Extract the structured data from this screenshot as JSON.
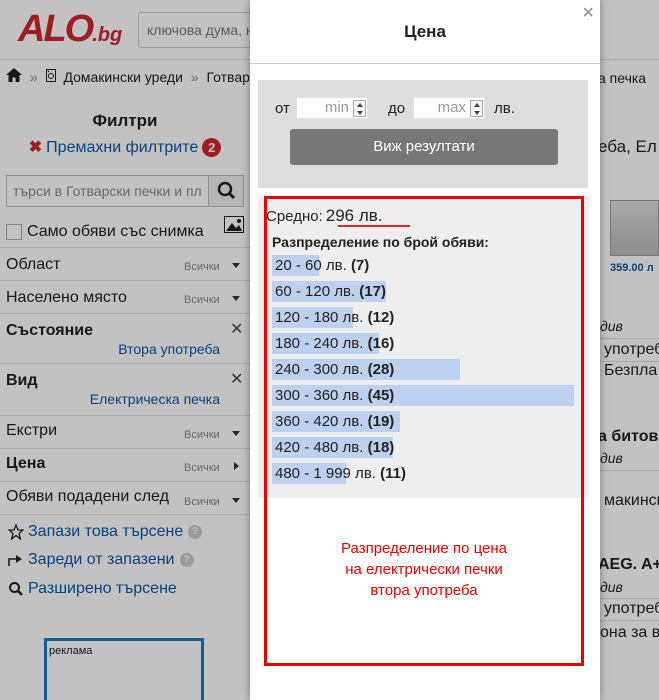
{
  "header": {
    "logo_main": "ALO",
    "logo_suffix": ".bg",
    "search_placeholder": "ключова дума, н"
  },
  "breadcrumb": {
    "items": [
      "Домакински уреди",
      "Готварс"
    ],
    "right_fragment": "а печка"
  },
  "sidebar": {
    "title": "Филтри",
    "remove_filters": "Премахни филтрите",
    "filters_count": "2",
    "search_placeholder": "търси в Готварски печки и пл",
    "photo_only": "Само обяви със снимка",
    "any_label": "Всички",
    "filters": [
      {
        "label": "Област",
        "value": "Всички"
      },
      {
        "label": "Населено място",
        "value": "Всички"
      },
      {
        "label": "Състояние",
        "value": "Втора употреба"
      },
      {
        "label": "Вид",
        "value": "Електрическа печка"
      },
      {
        "label": "Екстри",
        "value": "Всички"
      },
      {
        "label": "Цена",
        "value": "Всички"
      },
      {
        "label": "Обяви подадени след",
        "value": "Всички"
      }
    ],
    "links": [
      "Запази това търсене",
      "Зареди от запазени",
      "Разширено търсене"
    ],
    "ad_label": "реклама"
  },
  "right_column": {
    "heading_fragment": "еба, Ел",
    "price_1": "359.00 л",
    "items": [
      {
        "italic": "див",
        "line2": "употреб",
        "line3": "Безпла"
      },
      {
        "bold": "а битов",
        "italic": "див",
        "line3": "макинск"
      },
      {
        "bold": "AEG. A+",
        "italic": "див",
        "line2": "употреб",
        "line3": "она за вг"
      }
    ]
  },
  "modal": {
    "title": "Цена",
    "close": "×",
    "from_label": "от",
    "min_placeholder": "min",
    "to_label": "до",
    "max_placeholder": "max",
    "currency": "лв.",
    "show_results": "Виж резултати",
    "average_label": "Средно:",
    "average_value": "296 лв.",
    "distribution_title": "Разпределение по брой обяви:",
    "annotation": [
      "Разпределение по цена",
      "на електрически печки",
      "втора употреба"
    ]
  },
  "chart_data": {
    "type": "bar",
    "title": "Разпределение по брой обяви:",
    "categories": [
      "20 - 60 лв.",
      "60 - 120 лв.",
      "120 - 180 лв.",
      "180 - 240 лв.",
      "240 - 300 лв.",
      "300 - 360 лв.",
      "360 - 420 лв.",
      "420 - 480 лв.",
      "480 - 1 999 лв."
    ],
    "values": [
      7,
      17,
      12,
      16,
      28,
      45,
      19,
      18,
      11
    ],
    "value_labels": [
      "(7)",
      "(17)",
      "(12)",
      "(16)",
      "(28)",
      "(45)",
      "(19)",
      "(18)",
      "(11)"
    ],
    "orientation": "horizontal",
    "bar_color": "#bdd0f0"
  }
}
